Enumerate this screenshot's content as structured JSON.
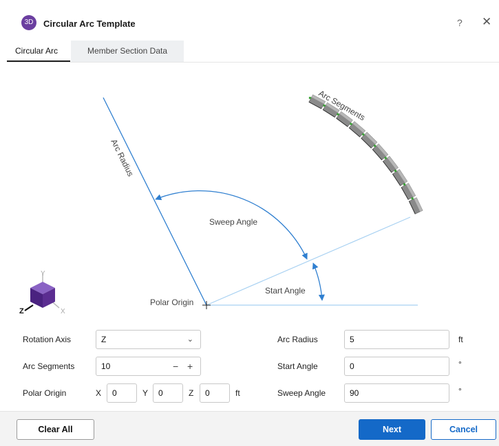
{
  "window": {
    "app_icon_text": "3D",
    "title": "Circular Arc Template",
    "help_label": "?",
    "close_label": "✕"
  },
  "tabs": [
    {
      "label": "Circular Arc",
      "active": true
    },
    {
      "label": "Member Section Data",
      "active": false
    }
  ],
  "diagram": {
    "labels": {
      "arc_segments": "Arc Segments",
      "arc_radius": "Arc Radius",
      "sweep_angle": "Sweep Angle",
      "start_angle": "Start Angle",
      "polar_origin": "Polar Origin"
    },
    "segment_count": 10,
    "colors": {
      "arrow": "#2f7fd0",
      "light_line": "#a8d1f2",
      "member": "#8a8a8a",
      "member_top": "#b7b7b7"
    }
  },
  "axes": {
    "y": "Y",
    "z": "Z",
    "x": "X",
    "cube_color": "#5b2d91"
  },
  "form": {
    "rotation_axis": {
      "label": "Rotation Axis",
      "value": "Z"
    },
    "arc_segments": {
      "label": "Arc Segments",
      "value": "10",
      "minus": "−",
      "plus": "+"
    },
    "polar_origin": {
      "label": "Polar Origin",
      "x_label": "X",
      "x_value": "0",
      "y_label": "Y",
      "y_value": "0",
      "z_label": "Z",
      "z_value": "0",
      "unit": "ft"
    },
    "arc_radius": {
      "label": "Arc Radius",
      "value": "5",
      "unit": "ft"
    },
    "start_angle": {
      "label": "Start Angle",
      "value": "0",
      "unit": "°"
    },
    "sweep_angle": {
      "label": "Sweep Angle",
      "value": "90",
      "unit": "°"
    }
  },
  "footer": {
    "clear_all": "Clear All",
    "next": "Next",
    "cancel": "Cancel"
  }
}
